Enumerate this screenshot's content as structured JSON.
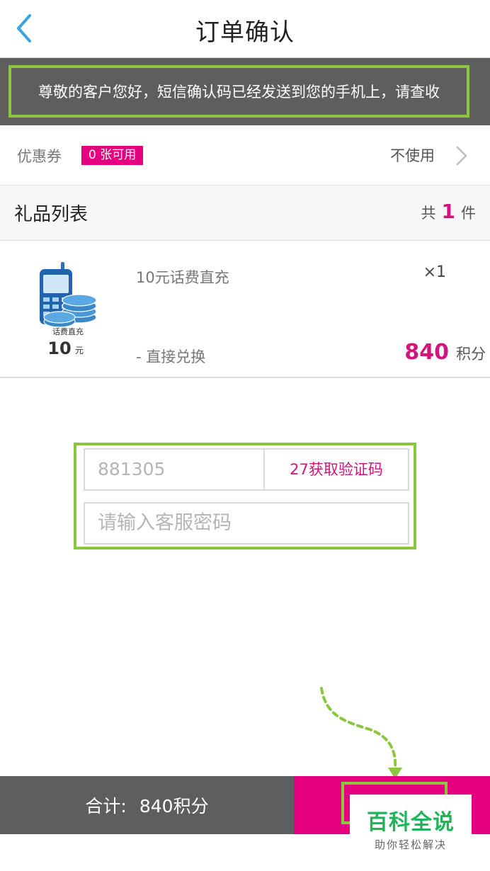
{
  "header": {
    "title": "订单确认"
  },
  "notice": {
    "text": "尊敬的客户您好，短信确认码已经发送到您的手机上，请查收"
  },
  "coupon": {
    "label": "优惠券",
    "badge": "0 张可用",
    "status": "不使用"
  },
  "gift_list": {
    "title": "礼品列表",
    "count_prefix": "共",
    "count": "1",
    "count_suffix": "件"
  },
  "item": {
    "name": "10元话费直充",
    "quantity": "×1",
    "method": "- 直接兑换",
    "price": "840",
    "unit": "积分",
    "image_caption": "话费直充",
    "image_amount": "10",
    "image_unit": "元"
  },
  "verify": {
    "code_value": "881305",
    "code_button": "27获取验证码",
    "password_placeholder": "请输入客服密码"
  },
  "footer": {
    "total_label": "合计:",
    "total_value": "840积分"
  },
  "watermark": {
    "title": "百科全说",
    "subtitle": "助你轻松解决"
  },
  "colors": {
    "accent": "#e4007f",
    "price": "#d1157b",
    "highlight": "#8cc63f",
    "dark_bar": "#5e5e5e",
    "back_icon": "#3aa3e3"
  }
}
